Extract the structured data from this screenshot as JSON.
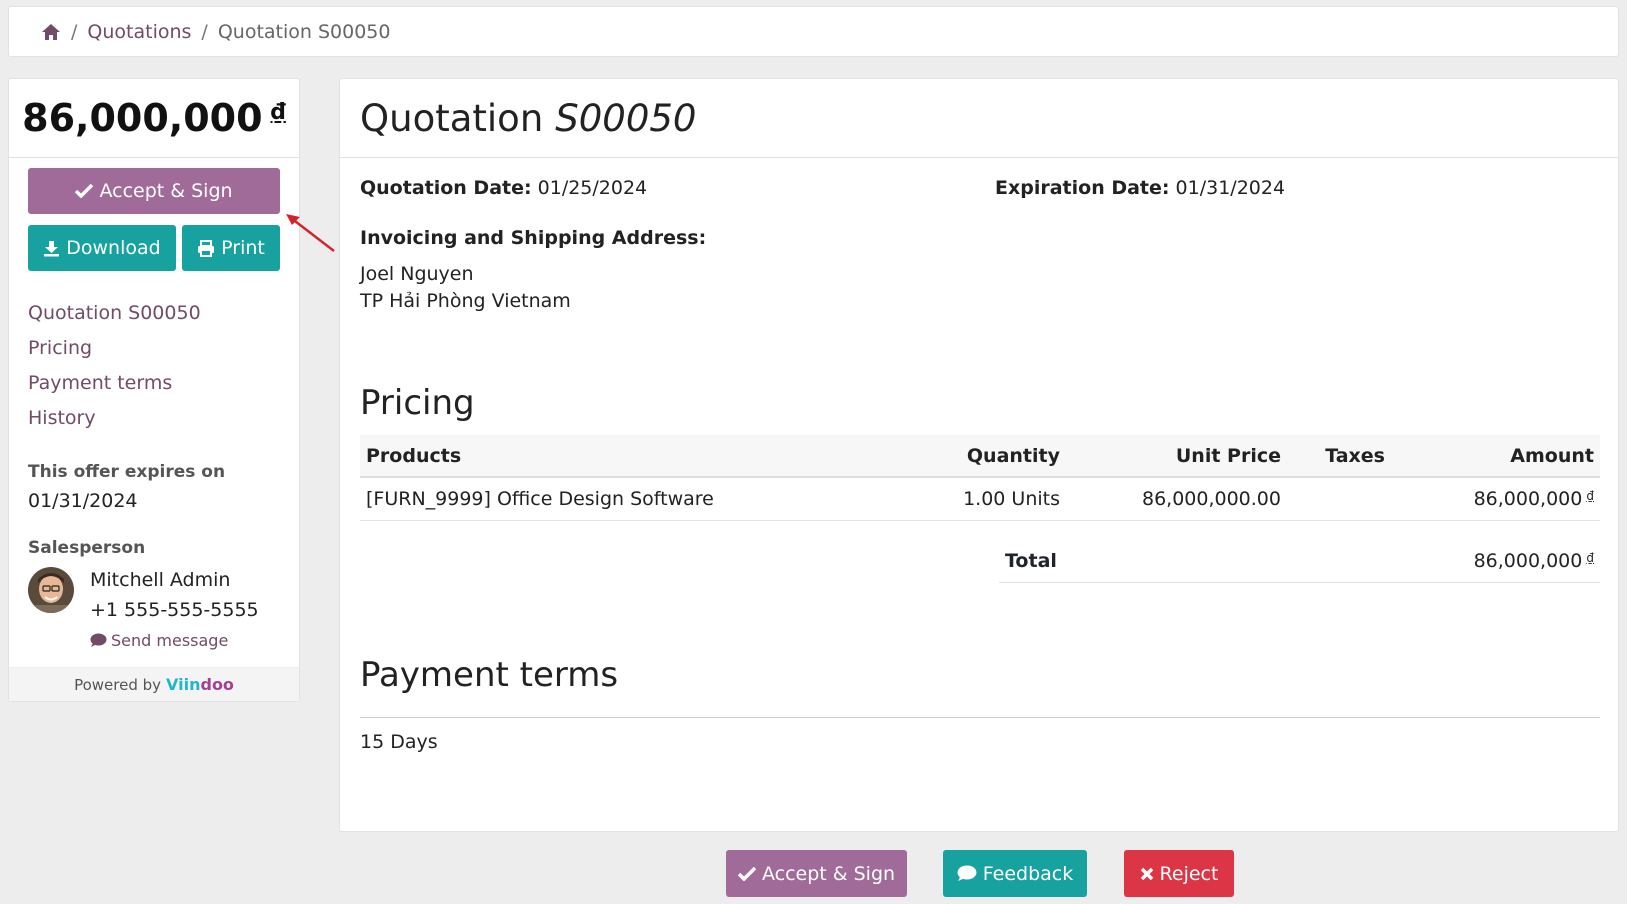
{
  "breadcrumb": {
    "items": [
      "Quotations",
      "Quotation S00050"
    ]
  },
  "sidebar": {
    "amount": "86,000,000",
    "currency": "₫",
    "accept_label": "Accept & Sign",
    "download_label": "Download",
    "print_label": "Print",
    "toc": [
      "Quotation S00050",
      "Pricing",
      "Payment terms",
      "History"
    ],
    "expires_label": "This offer expires on",
    "expires_date": "01/31/2024",
    "salesperson_label": "Salesperson",
    "salesperson_name": "Mitchell Admin",
    "salesperson_phone": "+1 555-555-5555",
    "send_message": "Send message",
    "powered_by": "Powered by",
    "brand_a": "Viin",
    "brand_b": "doo"
  },
  "main": {
    "title_prefix": "Quotation",
    "title_number": "S00050",
    "quotation_date_label": "Quotation Date:",
    "quotation_date": "01/25/2024",
    "expiration_date_label": "Expiration Date:",
    "expiration_date": "01/31/2024",
    "address_label": "Invoicing and Shipping Address:",
    "address_name": "Joel Nguyen",
    "address_city": "TP Hải Phòng Vietnam",
    "pricing_heading": "Pricing",
    "table": {
      "headers": [
        "Products",
        "Quantity",
        "Unit Price",
        "Taxes",
        "Amount"
      ],
      "rows": [
        {
          "product": "[FURN_9999] Office Design Software",
          "quantity": "1.00 Units",
          "unit_price": "86,000,000.00",
          "taxes": "",
          "amount": "86,000,000",
          "currency": "₫"
        }
      ],
      "total_label": "Total",
      "total_value": "86,000,000",
      "total_currency": "₫"
    },
    "payment_heading": "Payment terms",
    "payment_value": "15 Days"
  },
  "footer_actions": {
    "accept_label": "Accept & Sign",
    "feedback_label": "Feedback",
    "reject_label": "Reject"
  },
  "colors": {
    "purple": "#a06b98",
    "teal": "#17a2a0",
    "red": "#dc3545",
    "link": "#714b67"
  },
  "icons": [
    "home-icon",
    "check-icon",
    "download-icon",
    "print-icon",
    "comment-icon",
    "times-icon"
  ]
}
